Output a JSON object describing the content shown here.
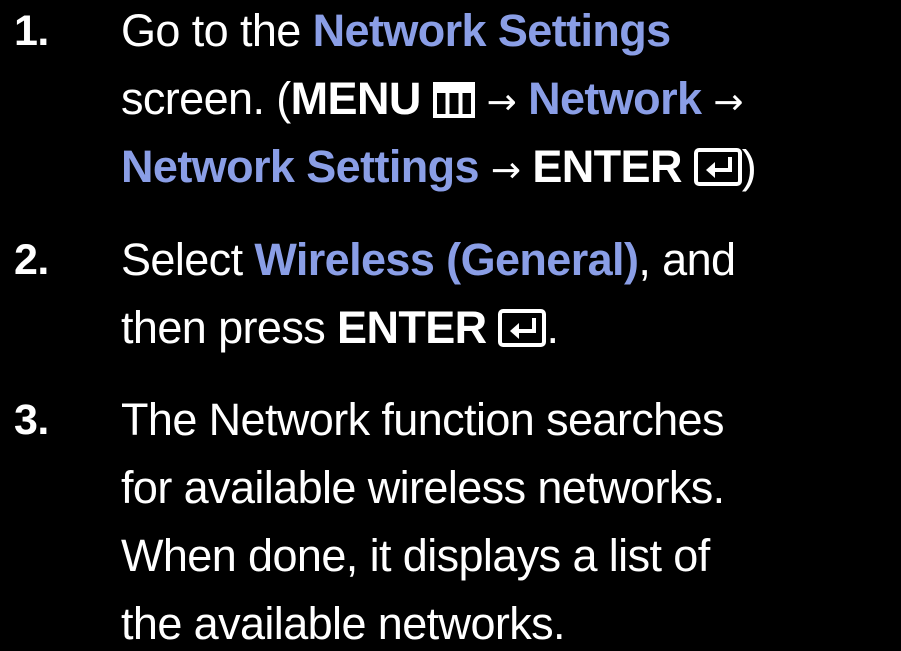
{
  "steps": [
    {
      "number": "1.",
      "lines": [
        {
          "pre": "Go to the ",
          "hl1": "Network Settings"
        },
        {
          "pre": "screen. (",
          "kw1": "MENU",
          "arrow": "→",
          "hl1": "Network",
          "arrow2": "→"
        },
        {
          "hl1": "Network Settings",
          "arrow": "→",
          "kw1": "ENTER",
          "post": ")"
        }
      ]
    },
    {
      "number": "2.",
      "lines": [
        {
          "pre": "Select ",
          "hl1": "Wireless (General)",
          "post": ", and"
        },
        {
          "pre": "then press ",
          "kw1": "ENTER",
          "post": "."
        }
      ]
    },
    {
      "number": "3.",
      "lines": [
        "The Network function searches",
        "for available wireless networks.",
        "When done, it displays a list of",
        "the available networks."
      ]
    }
  ],
  "icons": {
    "menu": "menu-icon",
    "enter": "enter-icon"
  },
  "colors": {
    "background": "#000000",
    "text": "#ffffff",
    "highlight": "#8a9ee6"
  }
}
